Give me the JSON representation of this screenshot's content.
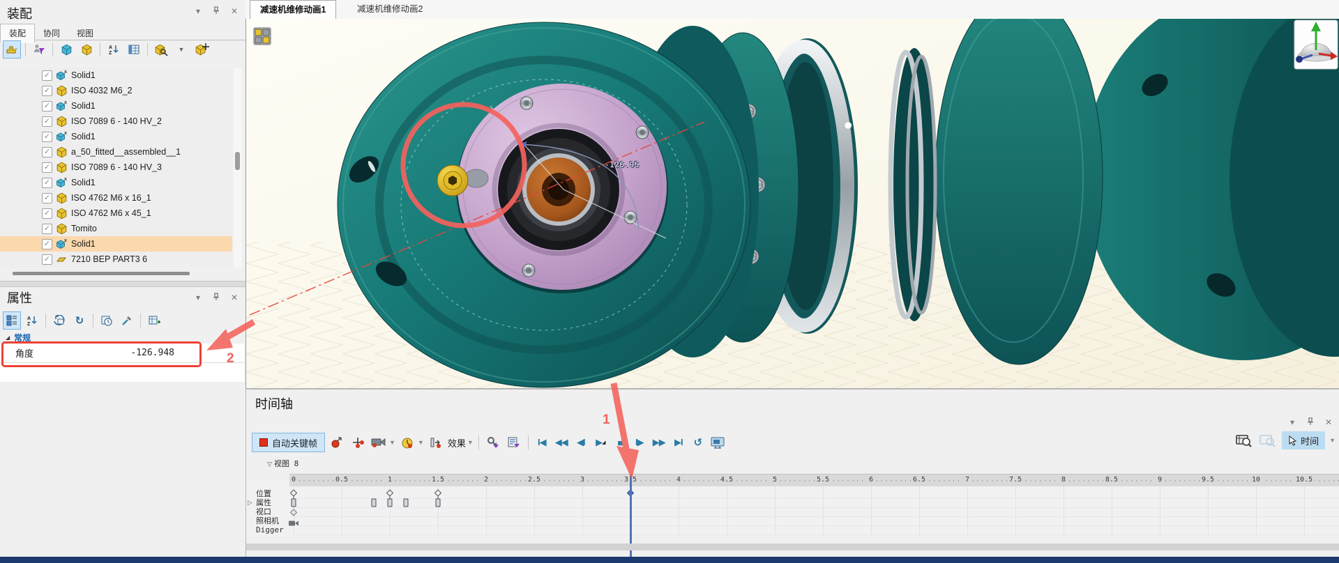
{
  "assembly_panel": {
    "title": "装配",
    "tabs": [
      {
        "label": "装配",
        "active": true
      },
      {
        "label": "协同",
        "active": false
      },
      {
        "label": "视图",
        "active": false
      }
    ],
    "toolbar": [
      "part-select",
      "divider",
      "filter",
      "divider",
      "insert-component",
      "insert-box",
      "divider",
      "sort-az",
      "table-view",
      "divider",
      "find-part",
      "dropdown",
      "constraint"
    ],
    "tree": [
      {
        "label": "Solid1",
        "icon": "solid",
        "checked": true,
        "highlighted": false
      },
      {
        "label": "ISO 4032 M6_2",
        "icon": "part",
        "checked": true,
        "highlighted": false
      },
      {
        "label": "Solid1",
        "icon": "solid",
        "checked": true,
        "highlighted": false
      },
      {
        "label": "ISO 7089 6 - 140 HV_2",
        "icon": "part",
        "checked": true,
        "highlighted": false
      },
      {
        "label": "Solid1",
        "icon": "solid",
        "checked": true,
        "highlighted": false
      },
      {
        "label": "a_50_fitted__assembled__1",
        "icon": "part",
        "checked": true,
        "highlighted": false
      },
      {
        "label": "ISO 7089 6 - 140 HV_3",
        "icon": "part",
        "checked": true,
        "highlighted": false
      },
      {
        "label": "Solid1",
        "icon": "solid",
        "checked": true,
        "highlighted": false
      },
      {
        "label": "ISO 4762 M6 x 16_1",
        "icon": "part",
        "checked": true,
        "highlighted": false
      },
      {
        "label": "ISO 4762 M6 x 45_1",
        "icon": "part",
        "checked": true,
        "highlighted": false
      },
      {
        "label": "Tomito",
        "icon": "part",
        "checked": true,
        "highlighted": false
      },
      {
        "label": "Solid1",
        "icon": "solid",
        "checked": true,
        "highlighted": true
      },
      {
        "label": "7210 BEP PART3 6",
        "icon": "sheet",
        "checked": true,
        "highlighted": false
      }
    ]
  },
  "properties_panel": {
    "title": "属性",
    "toolbar": [
      "category-view",
      "sort-az",
      "divider",
      "recalc",
      "refresh",
      "divider",
      "history",
      "picker",
      "divider",
      "add-table"
    ],
    "section_label": "常规",
    "rows": [
      {
        "label": "角度",
        "value": "-126.948"
      }
    ]
  },
  "viewport": {
    "tabs": [
      {
        "label": "减速机维修动画1",
        "active": true
      },
      {
        "label": "减速机维修动画2",
        "active": false
      }
    ],
    "dimension_label": "-126.95"
  },
  "annotations": {
    "step1": "1",
    "step2": "2",
    "accent_color": "#f4625c",
    "box_color": "#ee4136"
  },
  "timeline": {
    "title": "时间轴",
    "toolbar": {
      "auto_key": "自动关键帧",
      "effects": "效果",
      "time_mode": "时间"
    },
    "view_track_label": "视图 8",
    "ruler": {
      "tick_labels": [
        "0",
        "0.5",
        "1",
        "1.5",
        "2",
        "2.5",
        "3",
        "3.5",
        "4",
        "4.5",
        "5",
        "5.5",
        "6",
        "6.5",
        "7",
        "7.5",
        "8",
        "8.5",
        "9",
        "9.5",
        "10",
        "10.5"
      ],
      "step": 0.5
    },
    "playhead_t": 3.5,
    "tracks": [
      {
        "name": "位置",
        "keys": [
          {
            "t": 0,
            "type": "key"
          },
          {
            "t": 1,
            "type": "key"
          },
          {
            "t": 1.5,
            "type": "key"
          },
          {
            "t": 3.5,
            "type": "key-active"
          }
        ]
      },
      {
        "name": "属性",
        "expandable": true,
        "keys": [
          {
            "t": 0,
            "type": "bar"
          },
          {
            "t": 0.83,
            "type": "bar"
          },
          {
            "t": 1,
            "type": "bar"
          },
          {
            "t": 1.17,
            "type": "bar"
          },
          {
            "t": 1.5,
            "type": "bar"
          }
        ]
      },
      {
        "name": "视口",
        "keys": [
          {
            "t": 0,
            "type": "diamond"
          }
        ]
      },
      {
        "name": "照相机",
        "keys": [
          {
            "t": 0,
            "type": "camera"
          }
        ]
      },
      {
        "name": "Digger",
        "keys": []
      }
    ]
  }
}
